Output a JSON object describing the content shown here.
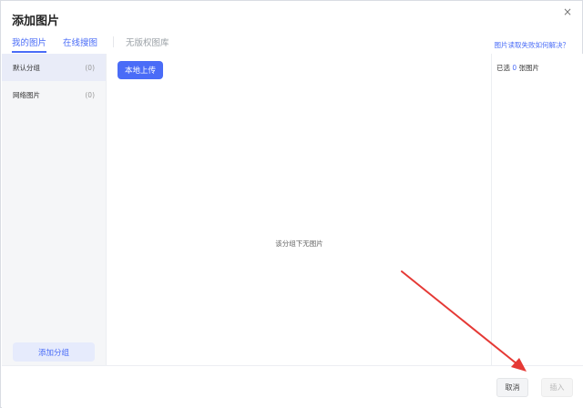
{
  "dialog": {
    "title": "添加图片",
    "close_glyph": "×"
  },
  "tabs": [
    {
      "label": "我的图片",
      "active": true
    },
    {
      "label": "在线搜图",
      "active": false
    },
    {
      "label": "无版权图库",
      "active": false
    }
  ],
  "help_link": "图片读取失败如何解决？",
  "sidebar": {
    "groups": [
      {
        "label": "默认分组",
        "count": "(0)",
        "active": true
      },
      {
        "label": "网络图片",
        "count": "(0)",
        "active": false
      }
    ],
    "add_group_label": "添加分组"
  },
  "main": {
    "upload_label": "本地上传",
    "empty_text": "该分组下无图片"
  },
  "selection": {
    "prefix": "已选",
    "count": "0",
    "suffix": "张图片"
  },
  "footer": {
    "cancel_label": "取消",
    "insert_label": "插入"
  },
  "colors": {
    "accent": "#4a6cf7",
    "annotation_arrow": "#e53935"
  }
}
